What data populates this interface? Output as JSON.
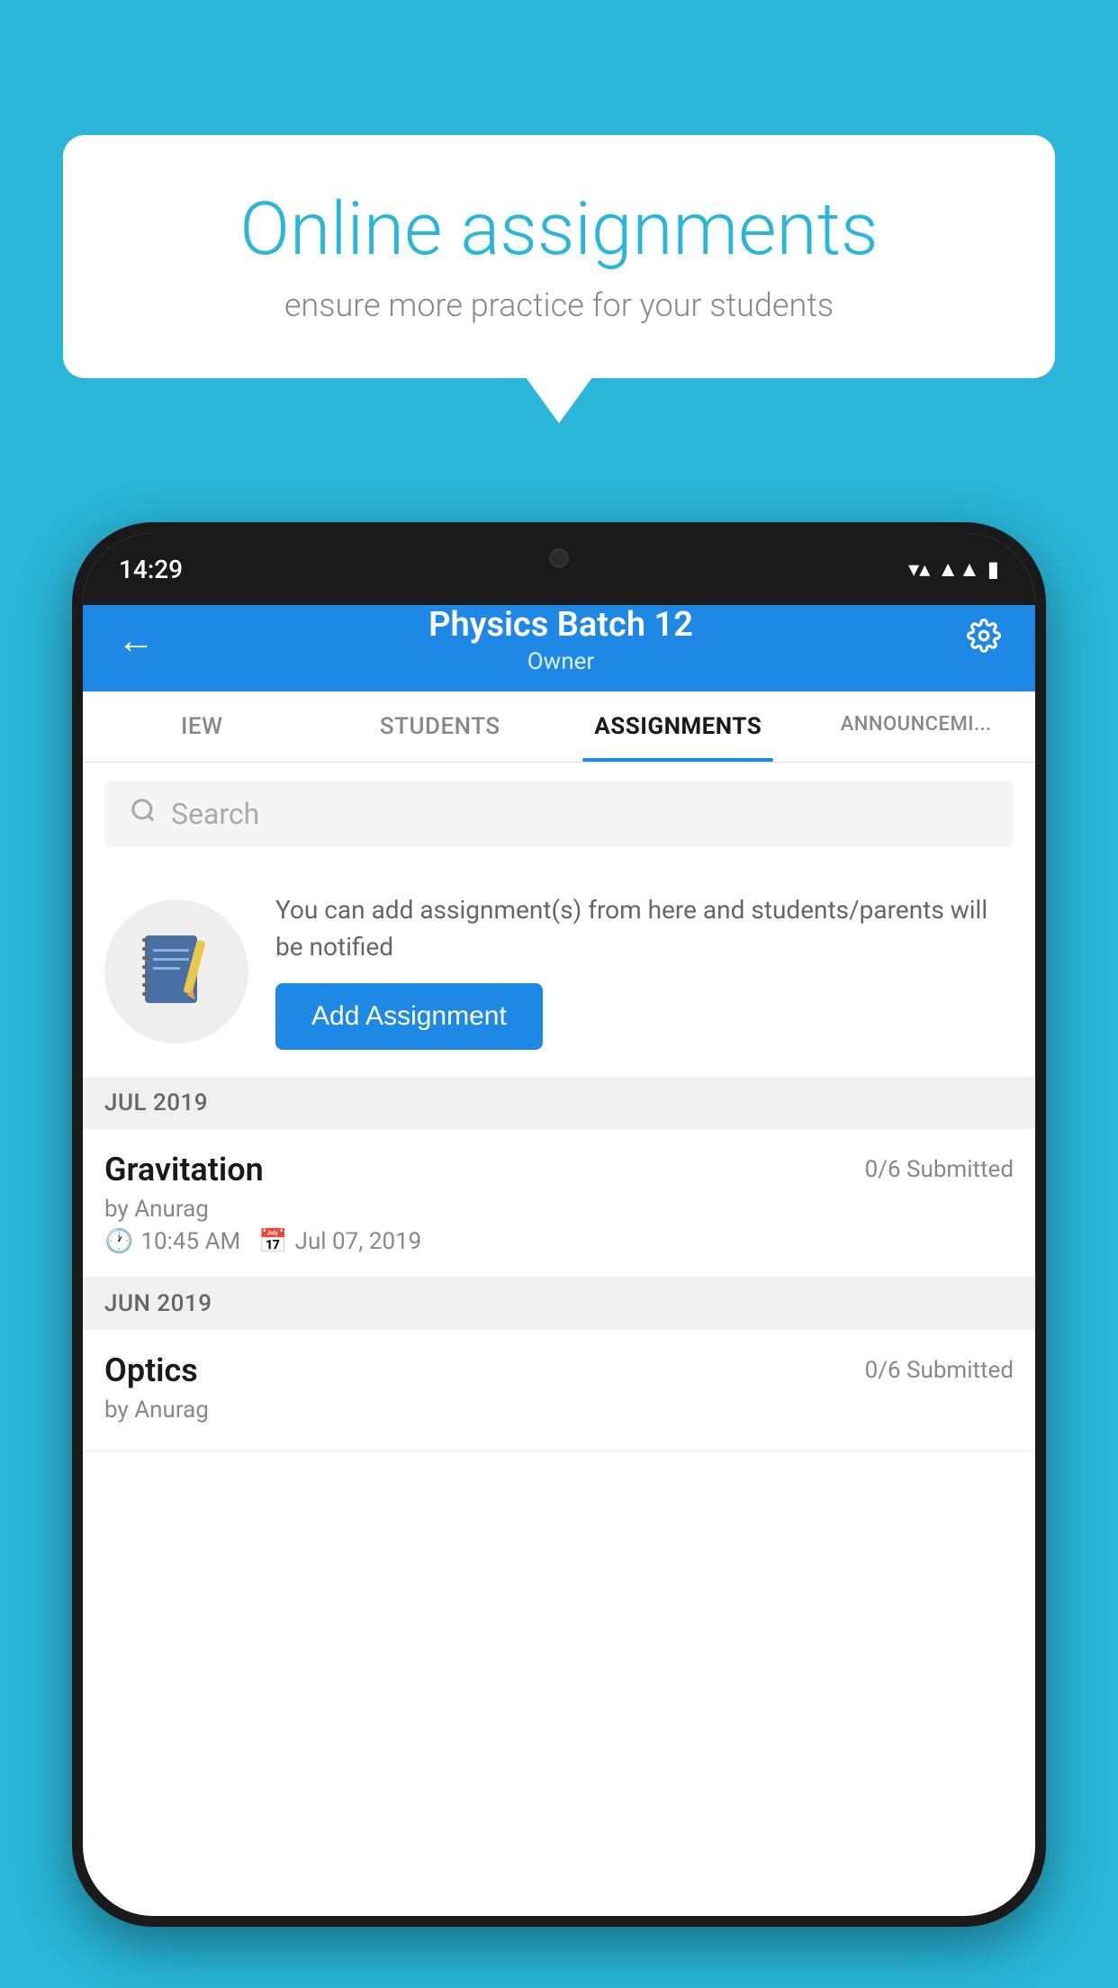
{
  "background_color": "#29b6d8",
  "bubble": {
    "title": "Online assignments",
    "subtitle": "ensure more practice for your students"
  },
  "phone": {
    "time": "14:29",
    "header": {
      "title": "Physics Batch 12",
      "subtitle": "Owner",
      "back_label": "←",
      "settings_label": "⚙"
    },
    "tabs": [
      {
        "label": "IEW",
        "active": false
      },
      {
        "label": "STUDENTS",
        "active": false
      },
      {
        "label": "ASSIGNMENTS",
        "active": true
      },
      {
        "label": "ANNOUNCEM...",
        "active": false
      }
    ],
    "search": {
      "placeholder": "Search"
    },
    "promo": {
      "text": "You can add assignment(s) from here and students/parents will be notified",
      "button_label": "Add Assignment"
    },
    "sections": [
      {
        "month": "JUL 2019",
        "assignments": [
          {
            "title": "Gravitation",
            "submitted": "0/6 Submitted",
            "author": "by Anurag",
            "time": "10:45 AM",
            "date": "Jul 07, 2019"
          }
        ]
      },
      {
        "month": "JUN 2019",
        "assignments": [
          {
            "title": "Optics",
            "submitted": "0/6 Submitted",
            "author": "by Anurag",
            "time": "",
            "date": ""
          }
        ]
      }
    ]
  }
}
